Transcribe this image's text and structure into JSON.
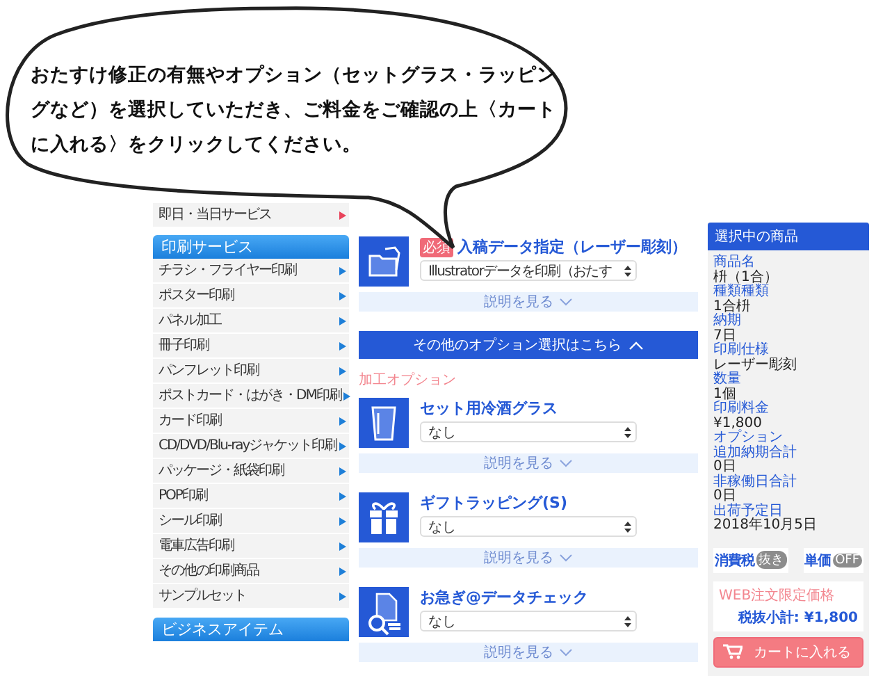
{
  "bubble": {
    "text": "おたすけ修正の有無やオプション（セットグラス・ラッピングなど）を選択していただき、ご料金をご確認の上〈カートに入れる〉をクリックしてください。"
  },
  "sidebar": {
    "top_item": {
      "label": "即日・当日サービス"
    },
    "sections": [
      {
        "title": "印刷サービス",
        "items": [
          "チラシ・フライヤー印刷",
          "ポスター印刷",
          "パネル加工",
          "冊子印刷",
          "パンフレット印刷",
          "ポストカード・はがき・DM印刷",
          "カード印刷",
          "CD/DVD/Blu-rayジャケット印刷",
          "パッケージ・紙袋印刷",
          "POP印刷",
          "シール印刷",
          "電車広告印刷",
          "その他の印刷商品",
          "サンプルセット"
        ]
      },
      {
        "title": "ビジネスアイテム"
      }
    ]
  },
  "main": {
    "required": {
      "kind": "folder",
      "badge": "必須",
      "title": "入稿データ指定（レーザー彫刻）",
      "select": "Illustratorデータを印刷（おたす",
      "explain": "説明を見る"
    },
    "more_button": {
      "label": "その他のオプション選択はこちら",
      "expanded": true
    },
    "section_label": "加工オプション",
    "options": [
      {
        "kind": "glass",
        "title": "セット用冷酒グラス",
        "select": "なし",
        "explain": "説明を見る"
      },
      {
        "kind": "gift",
        "title": "ギフトラッピング(S)",
        "select": "なし",
        "explain": "説明を見る"
      },
      {
        "kind": "check",
        "title": "お急ぎ@データチェック",
        "select": "なし",
        "explain": "説明を見る"
      }
    ]
  },
  "summary": {
    "title": "選択中の商品",
    "fields": [
      {
        "label": "商品名",
        "value": "枡（1合）"
      },
      {
        "label": "種類種類",
        "value": "1合枡"
      },
      {
        "label": "納期",
        "value": "7日"
      },
      {
        "label": "印刷仕様",
        "value": "レーザー彫刻"
      },
      {
        "label": "数量",
        "value": "1個"
      },
      {
        "label": "印刷料金",
        "value": "¥1,800"
      },
      {
        "label": "オプション"
      },
      {
        "label": "追加納期合計",
        "value": "0日"
      },
      {
        "label": "非稼働日合計",
        "value": "0日"
      },
      {
        "label": "出荷予定日",
        "value": "2018年10月5日"
      }
    ],
    "toggles": [
      {
        "label": "消費税",
        "state_text": "抜き",
        "on": false
      },
      {
        "label": "単価",
        "state_text": "OFF",
        "on": false
      }
    ],
    "price_note": "WEB注文限定価格",
    "subtotal": "税抜小計: ¥1,800",
    "cart_button": "カートに入れる"
  }
}
